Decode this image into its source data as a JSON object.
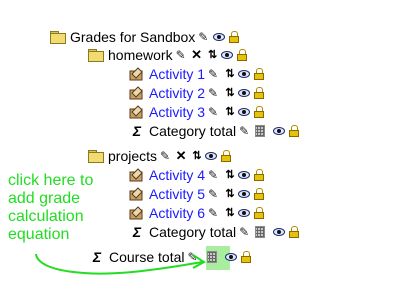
{
  "tree": {
    "root": {
      "label": "Grades for Sandbox"
    },
    "homework": {
      "label": "homework",
      "activities": [
        {
          "label": "Activity 1"
        },
        {
          "label": "Activity 2"
        },
        {
          "label": "Activity 3"
        }
      ],
      "total": {
        "label": "Category total"
      }
    },
    "projects": {
      "label": "projects",
      "activities": [
        {
          "label": "Activity 4"
        },
        {
          "label": "Activity 5"
        },
        {
          "label": "Activity 6"
        }
      ],
      "total": {
        "label": "Category total"
      }
    },
    "course_total": {
      "label": "Course total"
    }
  },
  "annotation": {
    "lines": [
      "click here to",
      "add grade",
      "calculation",
      "equation"
    ],
    "color": "#22dd22"
  },
  "icons": [
    "folder-icon",
    "activity-icon",
    "sigma-icon",
    "edit-icon",
    "delete-icon",
    "move-icon",
    "show-eye-icon",
    "lock-icon",
    "calculator-icon"
  ],
  "colors": {
    "link": "#1a1aff",
    "highlight": "#a9ee9f",
    "arrow": "#22dd22"
  }
}
